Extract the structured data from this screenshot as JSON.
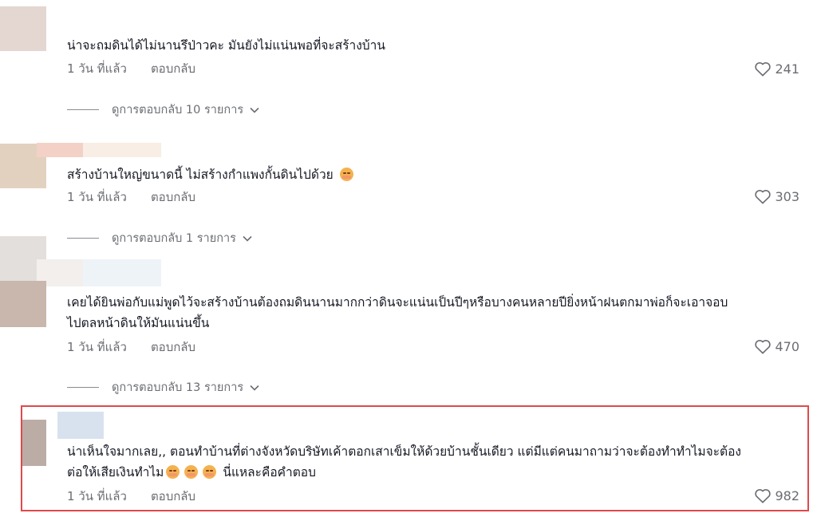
{
  "comments": [
    {
      "text": "น่าจะถมดินได้ไม่นานรึป่าวคะ มันยังไม่แน่นพอที่จะสร้างบ้าน",
      "time": "1 วัน ที่แล้ว",
      "reply_label": "ตอบกลับ",
      "likes": "241",
      "view_replies": "ดูการตอบกลับ 10 รายการ"
    },
    {
      "text": "สร้างบ้านใหญ่ขนาดนี้ ไม่สร้างกำแพงกั้นดินไปด้วย",
      "emoji": "flushed-face-emoji",
      "time": "1 วัน ที่แล้ว",
      "reply_label": "ตอบกลับ",
      "likes": "303",
      "view_replies": "ดูการตอบกลับ 1 รายการ"
    },
    {
      "text_line1": "เคยได้ยินพ่อกับแม่พูดไว้จะสร้างบ้านต้องถมดินนานมากกว่าดินจะแน่นเป็นปีๆหรือบางคนหลายปียิ่งหน้าฝนตกมาพ่อก็จะเอาจอบ",
      "text_line2": "ไปตลหน้าดินให้มันแน่นขึ้น",
      "time": "1 วัน ที่แล้ว",
      "reply_label": "ตอบกลับ",
      "likes": "470",
      "view_replies": "ดูการตอบกลับ 13 รายการ"
    },
    {
      "text_line1": "น่าเห็นใจมากเลย,, ตอนทำบ้านที่ต่างจังหวัดบริษัทเค้าตอกเสาเข็มให้ด้วยบ้านชั้นเดียว แต่มีแต่คนมาถามว่าจะต้องทำทำไมจะต้อง",
      "text_line2_start": "ต่อให้เสียเงินทำไม",
      "text_line2_end": "นี่แหละคือคำตอบ",
      "emoji": "pensive-face-emoji",
      "time": "1 วัน ที่แล้ว",
      "reply_label": "ตอบกลับ",
      "likes": "982"
    }
  ],
  "colors": {
    "highlight_border": "#e0494b",
    "text": "#161823",
    "muted": "#6b6d73"
  }
}
